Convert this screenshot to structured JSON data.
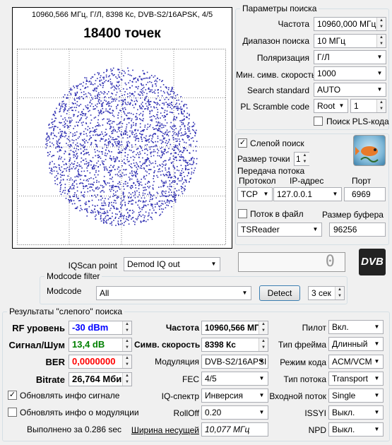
{
  "iq": {
    "info": "10960,566 МГц, Г/Л, 8398 Кс, DVB-S2/16APSK, 4/5",
    "points": "18400 точек"
  },
  "search": {
    "title": "Параметры поиска",
    "freq_label": "Частота",
    "freq": "10960,000 МГц",
    "range_label": "Диапазон поиска",
    "range": "10 МГц",
    "pol_label": "Поляризация",
    "pol": "Г/Л",
    "minsr_label": "Мин. симв. скорость",
    "minsr": "1000",
    "std_label": "Search standard",
    "std": "AUTO",
    "pls_label": "PL Scramble code",
    "pls_mode": "Root",
    "pls_val": "1",
    "pls_search": "Поиск PLS-кода"
  },
  "blind": {
    "label": "Слепой поиск",
    "dot_label": "Размер точки",
    "dot": "1"
  },
  "stream": {
    "title": "Передача потока",
    "proto_label": "Протокол",
    "ip_label": "IP-адрес",
    "port_label": "Порт",
    "proto": "TCP",
    "ip": "127.0.0.1",
    "port": "6969",
    "file_label": "Поток в файл",
    "buf_label": "Размер буфера",
    "app": "TSReader",
    "buf": "96256"
  },
  "iqscan": {
    "label": "IQScan point",
    "value": "Demod IQ out"
  },
  "signal_display": "0",
  "logo": "DVB",
  "modcode": {
    "title": "Modcode filter",
    "label": "Modcode",
    "value": "All",
    "detect": "Detect",
    "time": "3 сек"
  },
  "results": {
    "title": "Результаты \"слепого\" поиска",
    "rf_label": "RF уровень",
    "rf": "-30 dBm",
    "rf_color": "#0000ff",
    "snr_label": "Сигнал/Шум",
    "snr": "13,4 dB",
    "snr_color": "#008000",
    "ber_label": "BER",
    "ber": "0,0000000",
    "ber_color": "#ff0000",
    "bitrate_label": "Bitrate",
    "bitrate": "26,764 Мби",
    "upd_signal": "Обновлять инфо сигнале",
    "upd_mod": "Обновлять инфо о модуляции",
    "done": "Выполнено за 0.286 sec",
    "freq_label": "Частота",
    "freq": "10960,566 МГ",
    "sr_label": "Симв. скорость",
    "sr": "8398 Кс",
    "mod_label": "Модуляция",
    "mod": "DVB-S2/16APSI",
    "fec_label": "FEC",
    "fec": "4/5",
    "iqs_label": "IQ-спектр",
    "iqs": "Инверсия",
    "rolloff_label": "RollOff",
    "rolloff": "0.20",
    "bw_label": "Ширина несущей",
    "bw": "10,077 МГц",
    "pilot_label": "Пилот",
    "pilot": "Вкл.",
    "frame_label": "Тип фрейма",
    "frame": "Длинный",
    "code_label": "Режим кода",
    "code": "ACM/VCM",
    "stype_label": "Тип потока",
    "stype": "Transport",
    "instream_label": "Входной поток",
    "instream": "Single",
    "issyi_label": "ISSYI",
    "issyi": "Выкл.",
    "npd_label": "NPD",
    "npd": "Выкл."
  }
}
